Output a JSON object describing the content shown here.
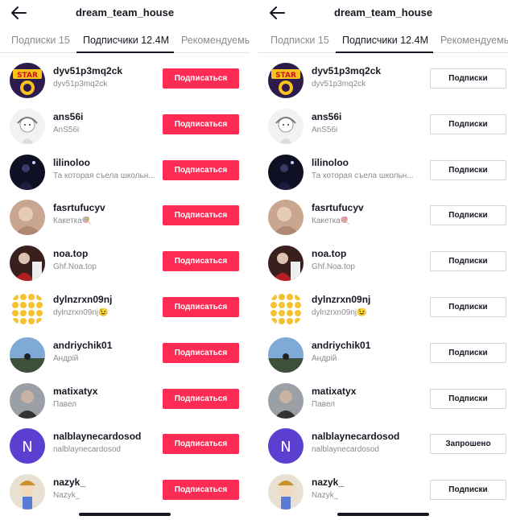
{
  "left": {
    "title": "dream_team_house",
    "tabs": [
      {
        "label": "Подписки 15"
      },
      {
        "label": "Подписчики 12.4M"
      },
      {
        "label": "Рекомендуемы"
      }
    ],
    "users": [
      {
        "username": "dyv51p3mq2ck",
        "nickname": "dyv51p3mq2ck",
        "button": "Подписаться"
      },
      {
        "username": "ans56i",
        "nickname": "AnS56i",
        "button": "Подписаться"
      },
      {
        "username": "lilinoloo",
        "nickname": "Та которая съела школьн...",
        "button": "Подписаться"
      },
      {
        "username": "fasrtufucyv",
        "nickname": "Какетка🍭",
        "button": "Подписаться"
      },
      {
        "username": "noa.top",
        "nickname": "Ghf.Noa.top",
        "button": "Подписаться"
      },
      {
        "username": "dylnzrxn09nj",
        "nickname": "dylnzrxn09nj😉",
        "button": "Подписаться"
      },
      {
        "username": "andriychik01",
        "nickname": "Андрій",
        "button": "Подписаться"
      },
      {
        "username": "matixatyx",
        "nickname": "Павел",
        "button": "Подписаться"
      },
      {
        "username": "nalblaynecardosod",
        "nickname": "nalblaynecardosod",
        "button": "Подписаться"
      },
      {
        "username": "nazyk_",
        "nickname": "Nazyk_",
        "button": "Подписаться"
      }
    ]
  },
  "right": {
    "title": "dream_team_house",
    "tabs": [
      {
        "label": "Подписки 15"
      },
      {
        "label": "Подписчики 12.4M"
      },
      {
        "label": "Рекомендуемы"
      }
    ],
    "users": [
      {
        "username": "dyv51p3mq2ck",
        "nickname": "dyv51p3mq2ck",
        "button": "Подписки"
      },
      {
        "username": "ans56i",
        "nickname": "AnS56i",
        "button": "Подписки"
      },
      {
        "username": "lilinoloo",
        "nickname": "Та которая съела школьн...",
        "button": "Подписки"
      },
      {
        "username": "fasrtufucyv",
        "nickname": "Какетка🍭",
        "button": "Подписки"
      },
      {
        "username": "noa.top",
        "nickname": "Ghf.Noa.top",
        "button": "Подписки"
      },
      {
        "username": "dylnzrxn09nj",
        "nickname": "dylnzrxn09nj😉",
        "button": "Подписки"
      },
      {
        "username": "andriychik01",
        "nickname": "Андрій",
        "button": "Подписки"
      },
      {
        "username": "matixatyx",
        "nickname": "Павел",
        "button": "Подписки"
      },
      {
        "username": "nalblaynecardosod",
        "nickname": "nalblaynecardosod",
        "button": "Запрошено"
      },
      {
        "username": "nazyk_",
        "nickname": "Nazyk_",
        "button": "Подписки"
      }
    ]
  },
  "avatar_letter": "N",
  "colors": {
    "accent": "#fe2c55",
    "text": "#161823",
    "muted": "#8a8b91",
    "avatar_n_bg": "#5b3fd1"
  },
  "icons": {
    "back": "arrow-left-icon"
  }
}
